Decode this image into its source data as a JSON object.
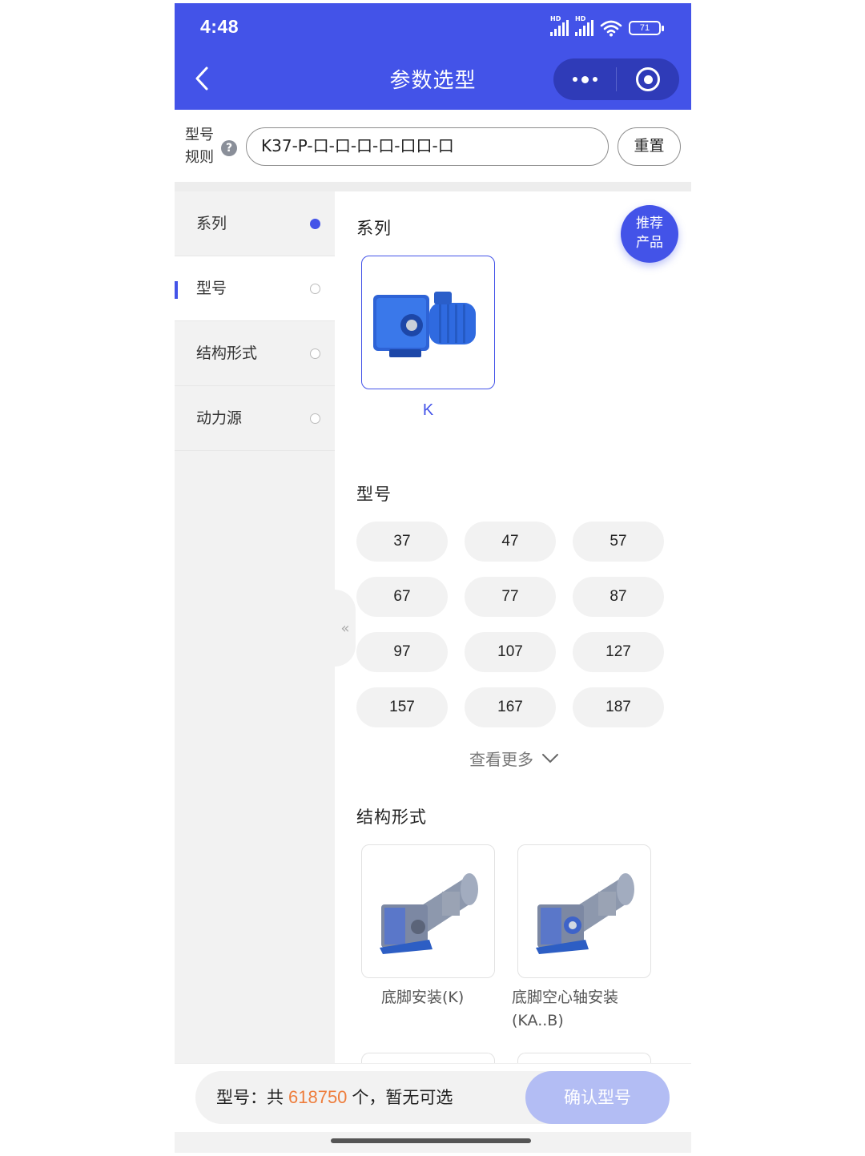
{
  "status_bar": {
    "time": "4:48",
    "battery": "71",
    "network_label": "HD"
  },
  "header": {
    "title": "参数选型"
  },
  "rule": {
    "label": "型号规则",
    "help": "?",
    "value": "K37-P-口-口-口-口-口口-口",
    "reset_label": "重置"
  },
  "sidebar": {
    "items": [
      {
        "label": "系列"
      },
      {
        "label": "型号"
      },
      {
        "label": "结构形式"
      },
      {
        "label": "动力源"
      }
    ]
  },
  "content": {
    "recommend_label_1": "推荐",
    "recommend_label_2": "产品",
    "series_title": "系列",
    "series_selected": "K",
    "model_title": "型号",
    "models": [
      "37",
      "47",
      "57",
      "67",
      "77",
      "87",
      "97",
      "107",
      "127",
      "157",
      "167",
      "187"
    ],
    "see_more": "查看更多",
    "structure_title": "结构形式",
    "structures": [
      {
        "label": "底脚安装(K)"
      },
      {
        "label": "底脚空心轴安装(KA..B)"
      }
    ]
  },
  "footer": {
    "prefix": "型号：共",
    "count": "618750",
    "suffix": "个，暂无可选",
    "confirm_label": "确认型号"
  },
  "colors": {
    "primary": "#4353e8",
    "count_orange": "#ee7d3c",
    "confirm_disabled": "#b3bdf4"
  }
}
